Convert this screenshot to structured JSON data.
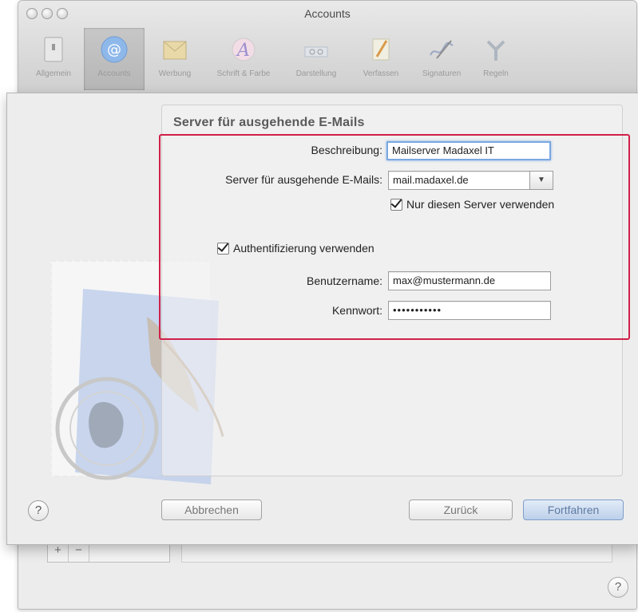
{
  "window": {
    "title": "Accounts"
  },
  "toolbar": {
    "items": [
      {
        "label": "Allgemein",
        "icon": "switch-icon"
      },
      {
        "label": "Accounts",
        "icon": "at-icon",
        "active": true
      },
      {
        "label": "Werbung",
        "icon": "envelope-icon"
      },
      {
        "label": "Schrift & Farbe",
        "icon": "font-icon"
      },
      {
        "label": "Darstellung",
        "icon": "glasses-icon"
      },
      {
        "label": "Verfassen",
        "icon": "pencil-icon"
      },
      {
        "label": "Signaturen",
        "icon": "signature-icon"
      },
      {
        "label": "Regeln",
        "icon": "rules-icon"
      }
    ]
  },
  "form": {
    "section_title": "Server für ausgehende E-Mails",
    "description_label": "Beschreibung:",
    "description_value": "Mailserver Madaxel IT",
    "server_label": "Server für ausgehende E-Mails:",
    "server_value": "mail.madaxel.de",
    "only_server_label": "Nur diesen Server verwenden",
    "auth_label": "Authentifizierung verwenden",
    "username_label": "Benutzername:",
    "username_value": "max@mustermann.de",
    "password_label": "Kennwort:",
    "password_value": "•••••••••••"
  },
  "buttons": {
    "help": "?",
    "cancel": "Abbrechen",
    "back": "Zurück",
    "continue": "Fortfahren"
  },
  "background": {
    "add": "+",
    "remove": "−",
    "help": "?"
  },
  "colors": {
    "highlight": "#d0204a",
    "focus": "#7aa7e0"
  }
}
